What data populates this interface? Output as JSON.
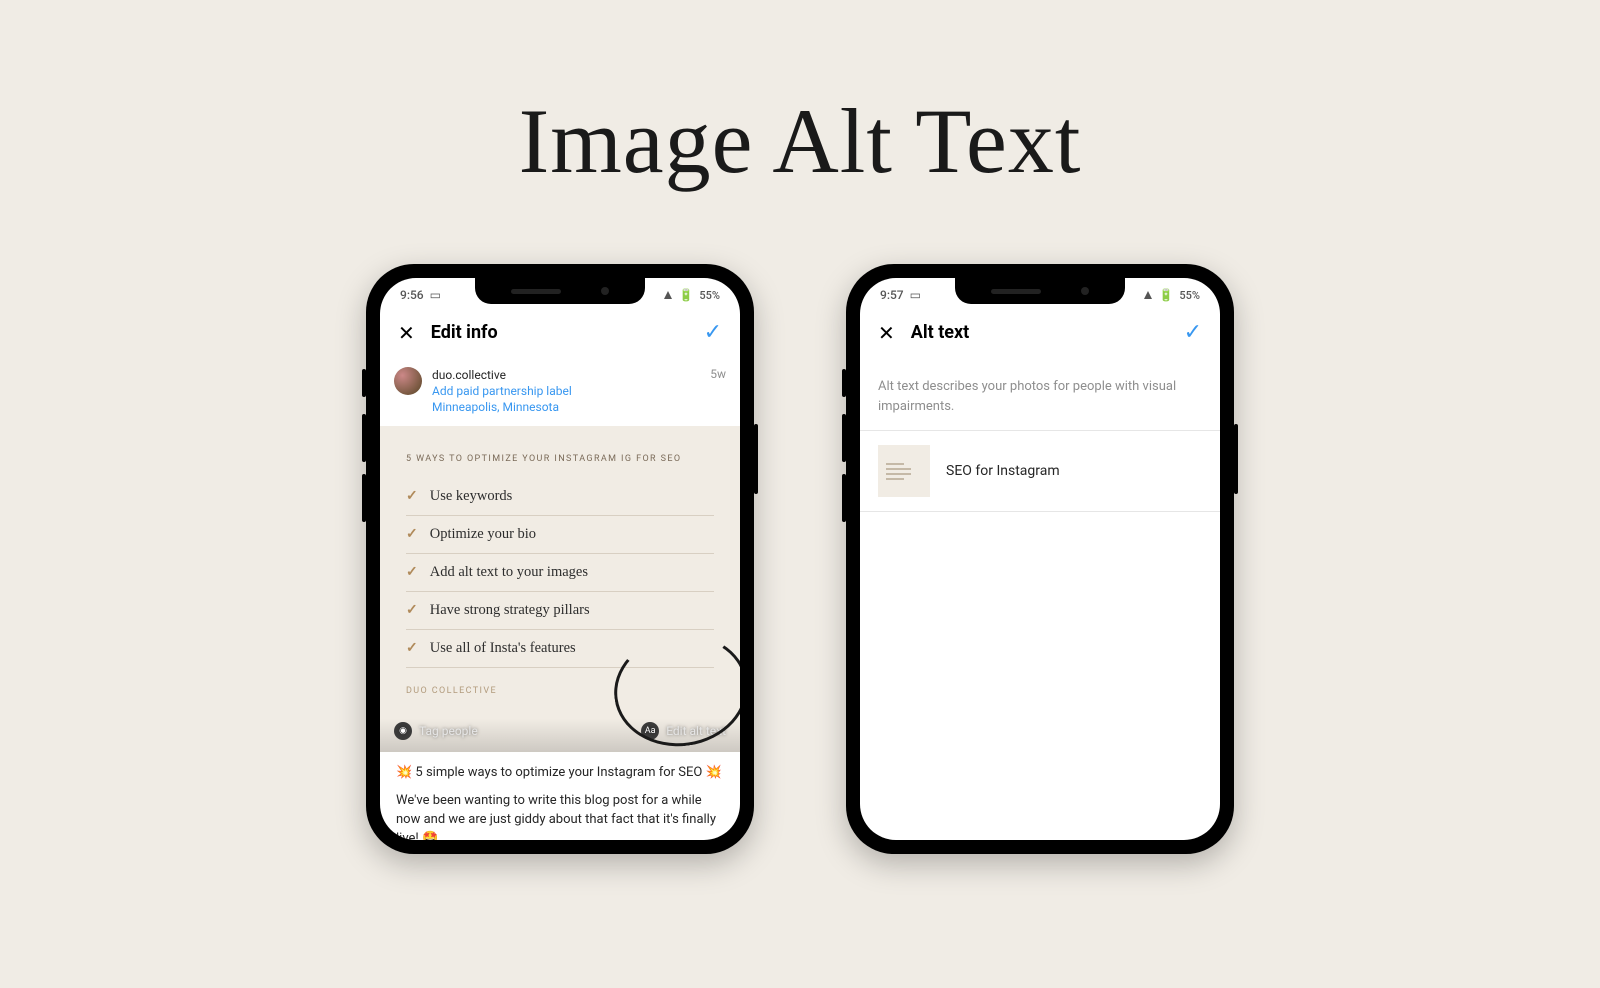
{
  "page_title": "Image Alt Text",
  "status": {
    "time1": "9:56",
    "time2": "9:57",
    "battery": "55%"
  },
  "phone1": {
    "header": "Edit info",
    "username": "duo.collective",
    "partnership_link": "Add paid partnership label",
    "location": "Minneapolis, Minnesota",
    "timestamp": "5w",
    "image_title": "5 WAYS TO OPTIMIZE YOUR INSTAGRAM IG FOR SEO",
    "tips": {
      "t1": "Use keywords",
      "t2": "Optimize your bio",
      "t3": "Add alt text to your images",
      "t4": "Have strong strategy pillars",
      "t5": "Use all of Insta's features"
    },
    "brand": "DUO COLLECTIVE",
    "tag_people": "Tag people",
    "edit_alt": "Edit alt text",
    "caption1": "💥 5 simple ways to optimize your Instagram for SEO 💥",
    "caption2": "We've been wanting to write this blog post for a while now and we are just giddy about that fact that it's finally live! 🤩"
  },
  "phone2": {
    "header": "Alt text",
    "description": "Alt text describes your photos for people with visual impairments.",
    "alt_value": "SEO for Instagram"
  }
}
